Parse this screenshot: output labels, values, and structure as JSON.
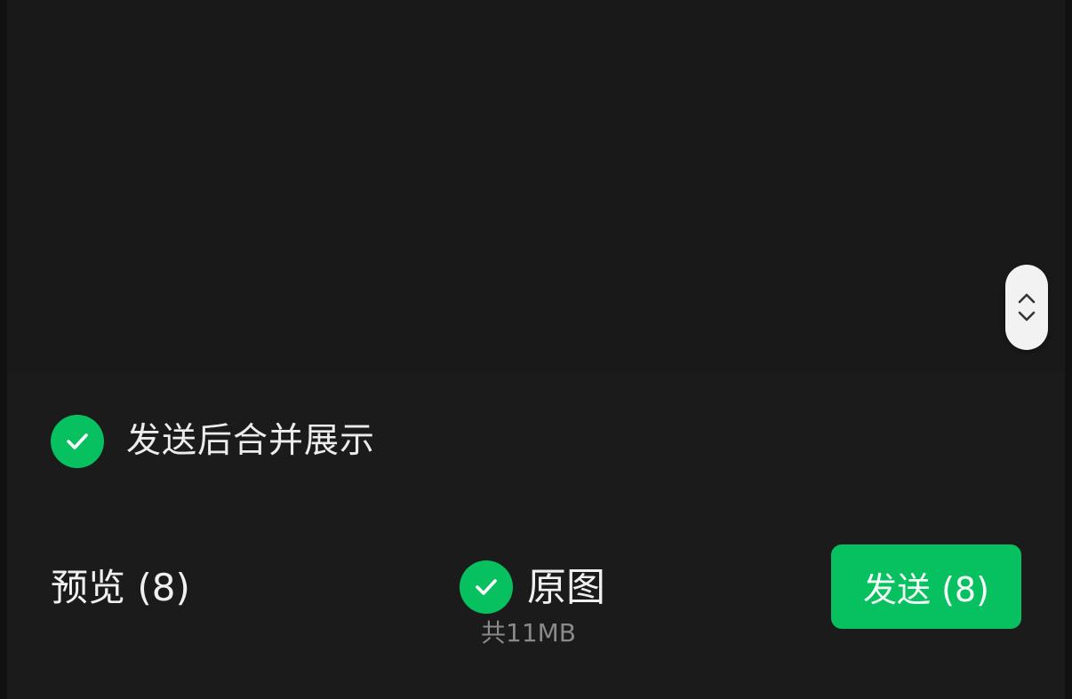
{
  "colors": {
    "accent": "#07c160",
    "background": "#191919",
    "text_primary": "#f0f0f0",
    "text_secondary": "#8a8a8a"
  },
  "scroll_handle": {
    "icons": [
      "chevron-up-icon",
      "chevron-down-icon"
    ]
  },
  "merge_option": {
    "checked": true,
    "icon": "checkmark-icon",
    "label": "发送后合并展示"
  },
  "bottom_bar": {
    "preview_label": "预览 (8)",
    "original": {
      "checked": true,
      "icon": "checkmark-icon",
      "label": "原图",
      "size_text": "共11MB"
    },
    "send_label": "发送 (8)"
  }
}
